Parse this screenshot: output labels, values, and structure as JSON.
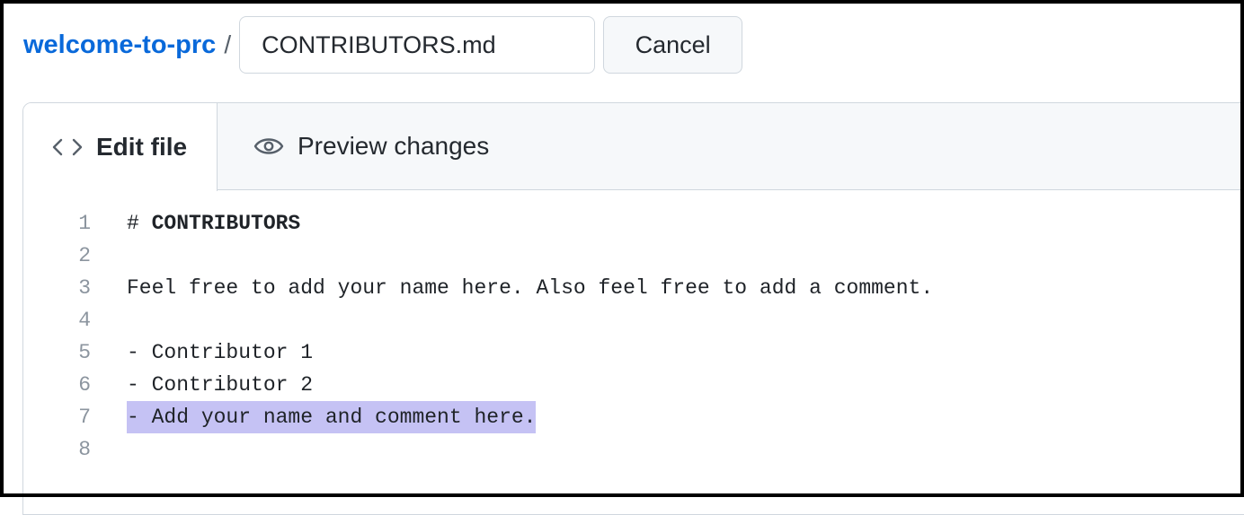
{
  "breadcrumb": {
    "repo": "welcome-to-prc",
    "separator": "/"
  },
  "filename_input": {
    "value": "CONTRIBUTORS.md"
  },
  "cancel_label": "Cancel",
  "tabs": [
    {
      "label": "Edit file",
      "icon": "code-icon",
      "active": true
    },
    {
      "label": "Preview changes",
      "icon": "eye-icon",
      "active": false
    }
  ],
  "editor": {
    "lines": [
      {
        "num": "1",
        "marker": "# ",
        "text": "CONTRIBUTORS"
      },
      {
        "num": "2",
        "text": ""
      },
      {
        "num": "3",
        "text": "Feel free to add your name here. Also feel free to add a comment."
      },
      {
        "num": "4",
        "text": ""
      },
      {
        "num": "5",
        "text": "- Contributor 1"
      },
      {
        "num": "6",
        "text": "- Contributor 2"
      },
      {
        "num": "7",
        "text": "- Add your name and comment here."
      },
      {
        "num": "8",
        "text": ""
      }
    ],
    "selection_color": "#c5c2f4"
  },
  "colors": {
    "link": "#0969da",
    "border": "#d0d7de",
    "tab_bg": "#f6f8fa"
  }
}
